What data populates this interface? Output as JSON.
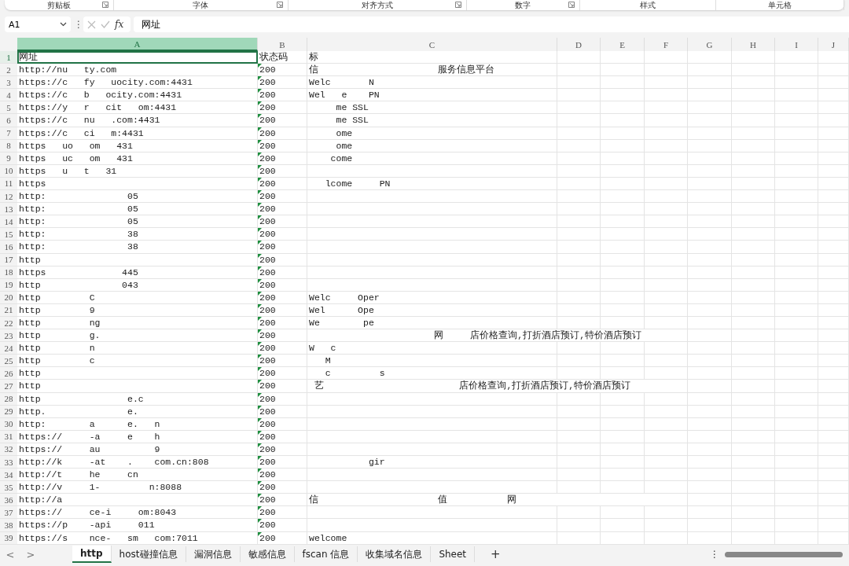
{
  "ribbon_groups": [
    {
      "label": "剪贴板",
      "launcher": true
    },
    {
      "label": "字体",
      "launcher": true
    },
    {
      "label": "对齐方式",
      "launcher": true
    },
    {
      "label": "数字",
      "launcher": true
    },
    {
      "label": "样式",
      "launcher": false
    },
    {
      "label": "单元格",
      "launcher": false
    }
  ],
  "formula_bar": {
    "name_box": "A1",
    "fx": "fx",
    "value": "网址"
  },
  "columns": [
    {
      "label": "A",
      "selected": true
    },
    {
      "label": "B",
      "selected": false
    },
    {
      "label": "C",
      "selected": false
    },
    {
      "label": "D",
      "selected": false
    },
    {
      "label": "E",
      "selected": false
    },
    {
      "label": "F",
      "selected": false
    },
    {
      "label": "G",
      "selected": false
    },
    {
      "label": "H",
      "selected": false
    },
    {
      "label": "I",
      "selected": false
    },
    {
      "label": "J",
      "selected": false
    }
  ],
  "rows": [
    {
      "num": "1",
      "selected": true,
      "url": "网址",
      "status": "状态码",
      "title": "标",
      "flag": false
    },
    {
      "num": "2",
      "selected": false,
      "url": "http://nu   ty.com",
      "status": "200",
      "title": "信                      服务信息平台",
      "flag": true
    },
    {
      "num": "3",
      "selected": false,
      "url": "https://c   fy   uocity.com:4431",
      "status": "200",
      "title": "Welc       N",
      "flag": true
    },
    {
      "num": "4",
      "selected": false,
      "url": "https://c   b   ocity.com:4431",
      "status": "200",
      "title": "Wel   e    PN",
      "flag": true
    },
    {
      "num": "5",
      "selected": false,
      "url": "https://y   r   cit   om:4431",
      "status": "200",
      "title": "     me SSL",
      "flag": true
    },
    {
      "num": "6",
      "selected": false,
      "url": "https://c   nu   .com:4431",
      "status": "200",
      "title": "     me SSL",
      "flag": true
    },
    {
      "num": "7",
      "selected": false,
      "url": "https://c   ci   m:4431",
      "status": "200",
      "title": "     ome",
      "flag": true
    },
    {
      "num": "8",
      "selected": false,
      "url": "https   uo   om   431",
      "status": "200",
      "title": "     ome",
      "flag": true
    },
    {
      "num": "9",
      "selected": false,
      "url": "https   uc   om   431",
      "status": "200",
      "title": "    come",
      "flag": true
    },
    {
      "num": "10",
      "selected": false,
      "url": "https   u   t   31",
      "status": "200",
      "title": "",
      "flag": true
    },
    {
      "num": "11",
      "selected": false,
      "url": "https",
      "status": "200",
      "title": "   lcome     PN",
      "flag": true
    },
    {
      "num": "12",
      "selected": false,
      "url": "http:               05",
      "status": "200",
      "title": "",
      "flag": true
    },
    {
      "num": "13",
      "selected": false,
      "url": "http:               05",
      "status": "200",
      "title": "",
      "flag": true
    },
    {
      "num": "14",
      "selected": false,
      "url": "http:               05",
      "status": "200",
      "title": "",
      "flag": true
    },
    {
      "num": "15",
      "selected": false,
      "url": "http:               38",
      "status": "200",
      "title": "",
      "flag": true
    },
    {
      "num": "16",
      "selected": false,
      "url": "http:               38",
      "status": "200",
      "title": "",
      "flag": true
    },
    {
      "num": "17",
      "selected": false,
      "url": "http",
      "status": "200",
      "title": "",
      "flag": true
    },
    {
      "num": "18",
      "selected": false,
      "url": "https              445",
      "status": "200",
      "title": "",
      "flag": true
    },
    {
      "num": "19",
      "selected": false,
      "url": "http               043",
      "status": "200",
      "title": "",
      "flag": true
    },
    {
      "num": "20",
      "selected": false,
      "url": "http         C",
      "status": "200",
      "title": "Welc     Oper",
      "flag": true
    },
    {
      "num": "21",
      "selected": false,
      "url": "http         9",
      "status": "200",
      "title": "Wel      Ope",
      "flag": true
    },
    {
      "num": "22",
      "selected": false,
      "url": "http         ng",
      "status": "200",
      "title": "We        pe",
      "flag": true
    },
    {
      "num": "23",
      "selected": false,
      "url": "http         g.",
      "status": "200",
      "title": "                       网     店价格查询,打折酒店预订,特价酒店预订",
      "flag": true
    },
    {
      "num": "24",
      "selected": false,
      "url": "http         n",
      "status": "200",
      "title": "W   c",
      "flag": true
    },
    {
      "num": "25",
      "selected": false,
      "url": "http         c",
      "status": "200",
      "title": "   M",
      "flag": true
    },
    {
      "num": "26",
      "selected": false,
      "url": "http",
      "status": "200",
      "title": "   c         s",
      "flag": true
    },
    {
      "num": "27",
      "selected": false,
      "url": "http",
      "status": "200",
      "title": " 艺                         店价格查询,打折酒店预订,特价酒店预订",
      "flag": true
    },
    {
      "num": "28",
      "selected": false,
      "url": "http                e.c",
      "status": "200",
      "title": "",
      "flag": true
    },
    {
      "num": "29",
      "selected": false,
      "url": "http.               e.",
      "status": "200",
      "title": "",
      "flag": true
    },
    {
      "num": "30",
      "selected": false,
      "url": "http:        a      e.   n",
      "status": "200",
      "title": "",
      "flag": true
    },
    {
      "num": "31",
      "selected": false,
      "url": "https://     -a     e    h",
      "status": "200",
      "title": "",
      "flag": true
    },
    {
      "num": "32",
      "selected": false,
      "url": "https://     au          9",
      "status": "200",
      "title": "",
      "flag": true
    },
    {
      "num": "33",
      "selected": false,
      "url": "http://k     -at    .    com.cn:808",
      "status": "200",
      "title": "           gir",
      "flag": true
    },
    {
      "num": "34",
      "selected": false,
      "url": "http://t     he     cn",
      "status": "200",
      "title": "",
      "flag": true
    },
    {
      "num": "35",
      "selected": false,
      "url": "http://v     1-         n:8088",
      "status": "200",
      "title": "",
      "flag": true
    },
    {
      "num": "36",
      "selected": false,
      "url": "http://a",
      "status": "200",
      "title": "信                      值           网",
      "flag": true
    },
    {
      "num": "37",
      "selected": false,
      "url": "https://     ce-i     om:8043",
      "status": "200",
      "title": "",
      "flag": true
    },
    {
      "num": "38",
      "selected": false,
      "url": "https://p    -api     011",
      "status": "200",
      "title": "",
      "flag": true
    },
    {
      "num": "39",
      "selected": false,
      "url": "https://s    nce-   sm   com:7011",
      "status": "200",
      "title": "welcome",
      "flag": true
    }
  ],
  "sheet_nav": [
    "<",
    ">"
  ],
  "sheet_tabs": [
    {
      "label": "http",
      "selected": true
    },
    {
      "label": "host碰撞信息",
      "selected": false
    },
    {
      "label": "漏洞信息",
      "selected": false
    },
    {
      "label": "敏感信息",
      "selected": false
    },
    {
      "label": "fscan    信息",
      "selected": false
    },
    {
      "label": "收集域名信息",
      "selected": false
    },
    {
      "label": "Sheet",
      "selected": false
    }
  ],
  "add_sheet": "+",
  "more": "⋮"
}
